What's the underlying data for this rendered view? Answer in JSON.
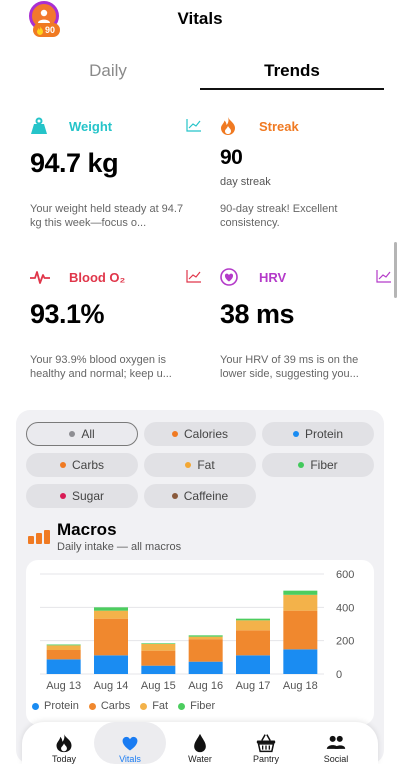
{
  "header": {
    "title": "Vitals",
    "streak_badge": "90",
    "avatar_icon": "person-icon",
    "flame_icon": "flame-icon"
  },
  "tabs": [
    {
      "label": "Daily",
      "active": false
    },
    {
      "label": "Trends",
      "active": true
    }
  ],
  "cards": {
    "weight": {
      "title": "Weight",
      "color": "#25c4c9",
      "icon": "weight-icon",
      "value": "94.7 kg",
      "description": "Your weight held steady at 94.7 kg this week—focus o..."
    },
    "streak": {
      "title": "Streak",
      "color": "#f07a22",
      "icon": "flame-icon",
      "value": "90",
      "subtitle": "day streak",
      "description": "90-day streak! Excellent consistency."
    },
    "blood_o2": {
      "title": "Blood O₂",
      "color": "#e0364a",
      "icon": "pulse-icon",
      "value": "93.1%",
      "description": "Your 93.9% blood oxygen is healthy and normal; keep u..."
    },
    "hrv": {
      "title": "HRV",
      "color": "#b43ac9",
      "icon": "heart-icon",
      "value": "38 ms",
      "description": "Your HRV of 39 ms is on the lower side, suggesting you..."
    }
  },
  "filters": [
    {
      "label": "All",
      "color": "#8e8e93",
      "selected": true
    },
    {
      "label": "Calories",
      "color": "#f07a22",
      "selected": false
    },
    {
      "label": "Protein",
      "color": "#1a8cf2",
      "selected": false
    },
    {
      "label": "Carbs",
      "color": "#f07a22",
      "selected": false
    },
    {
      "label": "Fat",
      "color": "#f3a733",
      "selected": false
    },
    {
      "label": "Fiber",
      "color": "#42c95c",
      "selected": false
    },
    {
      "label": "Sugar",
      "color": "#d81b55",
      "selected": false
    },
    {
      "label": "Caffeine",
      "color": "#8a5a3c",
      "selected": false
    }
  ],
  "macros": {
    "title": "Macros",
    "subtitle": "Daily intake — all macros"
  },
  "chart_data": {
    "type": "bar",
    "stacked": true,
    "categories": [
      "Aug 13",
      "Aug 14",
      "Aug 15",
      "Aug 16",
      "Aug 17",
      "Aug 18"
    ],
    "series": [
      {
        "name": "Protein",
        "color": "#1a8cf2",
        "values": [
          88,
          112,
          50,
          74,
          112,
          148
        ]
      },
      {
        "name": "Carbs",
        "color": "#f0882e",
        "values": [
          56,
          220,
          90,
          135,
          150,
          232
        ]
      },
      {
        "name": "Fat",
        "color": "#f3b24a",
        "values": [
          28,
          48,
          40,
          15,
          60,
          95
        ]
      },
      {
        "name": "Fiber",
        "color": "#4ccd5f",
        "values": [
          5,
          20,
          4,
          8,
          10,
          25
        ]
      }
    ],
    "yticks": [
      "0",
      "200",
      "400",
      "600"
    ],
    "ylim": [
      0,
      600
    ],
    "grid": true,
    "legend_position": "bottom"
  },
  "tabbar": [
    {
      "label": "Today",
      "icon": "flame-icon",
      "active": false
    },
    {
      "label": "Vitals",
      "icon": "heart-icon",
      "active": true
    },
    {
      "label": "Water",
      "icon": "drop-icon",
      "active": false
    },
    {
      "label": "Pantry",
      "icon": "basket-icon",
      "active": false
    },
    {
      "label": "Social",
      "icon": "people-icon",
      "active": false
    }
  ]
}
